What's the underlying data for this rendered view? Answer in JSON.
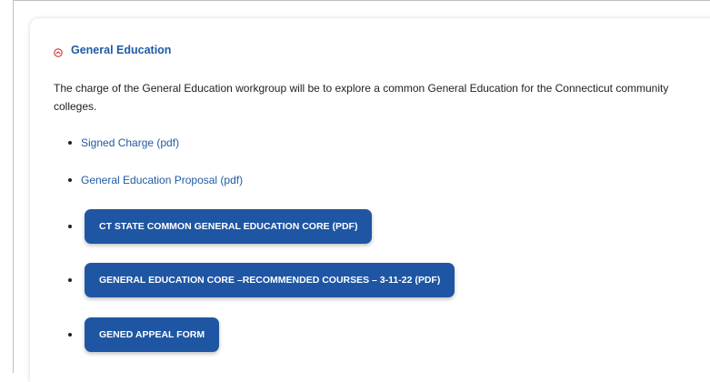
{
  "section": {
    "title": "General Education",
    "icon": "chevron-up-circle-icon",
    "accent_color": "#c8372d",
    "title_color": "#1f5aa6"
  },
  "description": "The charge of the General Education workgroup will be to explore a common General Education for the Connecticut community colleges.",
  "links": [
    {
      "label": "Signed Charge (pdf)"
    },
    {
      "label": "General Education Proposal (pdf)"
    }
  ],
  "buttons": [
    {
      "label": "CT STATE COMMON GENERAL EDUCATION CORE (PDF)"
    },
    {
      "label": "GENERAL EDUCATION CORE –RECOMMENDED COURSES – 3-11-22 (PDF)"
    },
    {
      "label": "GENED APPEAL FORM"
    }
  ],
  "colors": {
    "button_bg": "#1f56a3",
    "link": "#1f5aa6",
    "text": "#222222"
  }
}
